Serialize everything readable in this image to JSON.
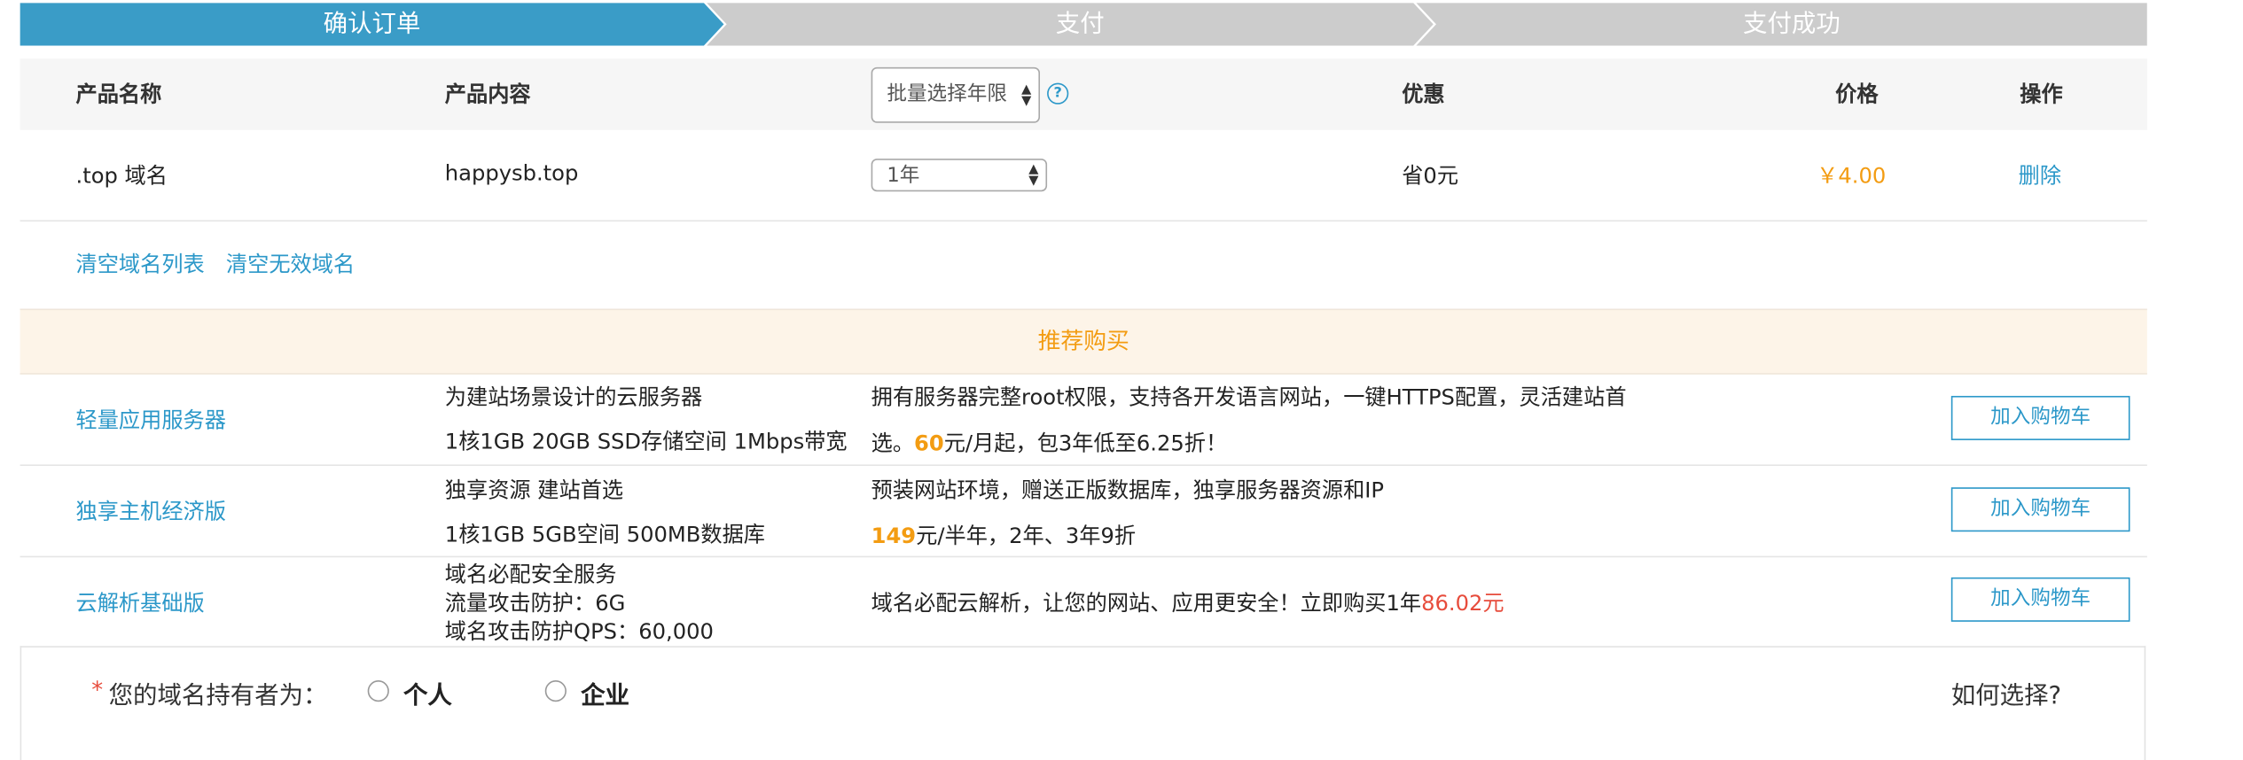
{
  "steps": [
    {
      "label": "确认订单",
      "active": true
    },
    {
      "label": "支付",
      "active": false
    },
    {
      "label": "支付成功",
      "active": false
    }
  ],
  "colors": {
    "active_step": "#3a9cc7",
    "inactive_step": "#cccccc",
    "link": "#2c98c9",
    "accent_orange": "#f39c12",
    "accent_red": "#e74c3c"
  },
  "table": {
    "headers": {
      "name": "产品名称",
      "content": "产品内容",
      "discount": "优惠",
      "price": "价格",
      "action": "操作"
    },
    "batch_select": "批量选择年限",
    "help_icon": "?",
    "rows": [
      {
        "name": ".top 域名",
        "content": "happysb.top",
        "period": "1年",
        "discount": "省0元",
        "price": "￥4.00",
        "action": "删除"
      }
    ]
  },
  "list_actions": {
    "clear_list": "清空域名列表",
    "clear_invalid": "清空无效域名"
  },
  "recommend": {
    "title": "推荐购买",
    "button_label": "加入购物车",
    "items": [
      {
        "name": "轻量应用服务器",
        "spec_line1": "为建站场景设计的云服务器",
        "spec_line2": "1核1GB 20GB SSD存储空间 1Mbps带宽",
        "desc_line1": "拥有服务器完整root权限，支持各开发语言网站，一键HTTPS配置，灵活建站首",
        "desc_prefix": "选。",
        "desc_highlight": "60",
        "desc_suffix": "元/月起，包3年低至6.25折！"
      },
      {
        "name": "独享主机经济版",
        "spec_line1": "独享资源 建站首选",
        "spec_line2": "1核1GB 5GB空间 500MB数据库",
        "desc_line1": "预装网站环境，赠送正版数据库，独享服务器资源和IP",
        "desc_highlight": "149",
        "desc_suffix": "元/半年，2年、3年9折"
      },
      {
        "name": "云解析基础版",
        "spec_line1": "域名必配安全服务",
        "spec_line2": "流量攻击防护：6G",
        "spec_line3": "域名攻击防护QPS：60,000",
        "desc_text": "域名必配云解析，让您的网站、应用更安全！立即购买1年",
        "desc_highlight": "86.02元"
      }
    ]
  },
  "owner": {
    "required_mark": "*",
    "label": "您的域名持有者为：",
    "options": [
      "个人",
      "企业"
    ],
    "how_to_choose": "如何选择?"
  }
}
